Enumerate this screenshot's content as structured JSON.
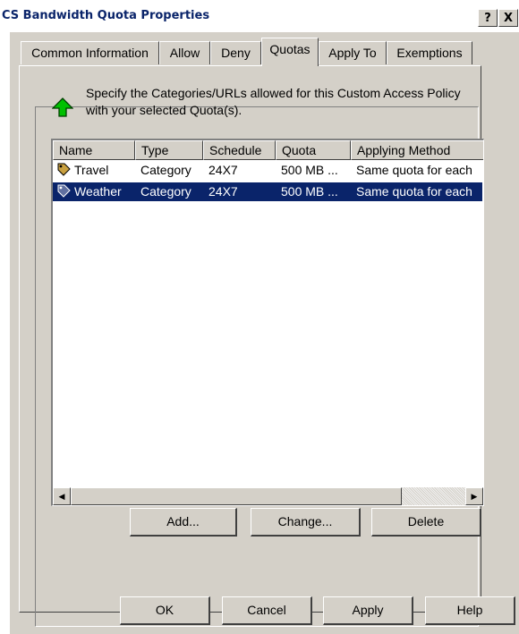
{
  "window": {
    "title": "CS Bandwidth Quota Properties",
    "help_label": "?",
    "close_label": "X"
  },
  "tabs": [
    {
      "label": "Common Information",
      "active": false
    },
    {
      "label": "Allow",
      "active": false
    },
    {
      "label": "Deny",
      "active": false
    },
    {
      "label": "Quotas",
      "active": true
    },
    {
      "label": "Apply To",
      "active": false
    },
    {
      "label": "Exemptions",
      "active": false
    }
  ],
  "panel": {
    "icon": "green-up-arrow-icon",
    "description": "Specify the Categories/URLs allowed for this Custom Access Policy with your selected Quota(s)."
  },
  "list": {
    "columns": [
      "Name",
      "Type",
      "Schedule",
      "Quota",
      "Applying Method"
    ],
    "rows": [
      {
        "icon": "category-icon",
        "name": "Travel",
        "type": "Category",
        "schedule": "24X7",
        "quota": "500 MB ...",
        "method": "Same quota for each",
        "selected": false
      },
      {
        "icon": "category-icon",
        "name": "Weather",
        "type": "Category",
        "schedule": "24X7",
        "quota": "500 MB ...",
        "method": "Same quota for each",
        "selected": true
      }
    ]
  },
  "actions": {
    "add": "Add...",
    "change": "Change...",
    "delete": "Delete"
  },
  "footer": {
    "ok": "OK",
    "cancel": "Cancel",
    "apply": "Apply",
    "help": "Help"
  },
  "colors": {
    "selection": "#0a246a",
    "face": "#d4d0c8",
    "arrow": "#00c000"
  }
}
